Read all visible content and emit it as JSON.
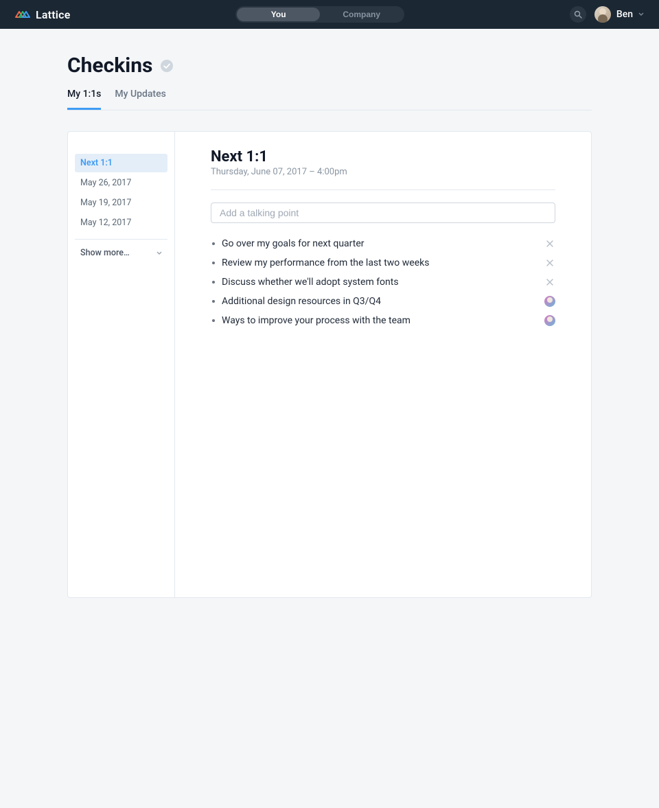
{
  "topbar": {
    "brand_name": "Lattice",
    "toggle": {
      "you": "You",
      "company": "Company"
    },
    "user_name": "Ben"
  },
  "page": {
    "title": "Checkins",
    "tabs": [
      {
        "label": "My 1:1s",
        "active": true
      },
      {
        "label": "My Updates",
        "active": false
      }
    ]
  },
  "sidebar": {
    "items": [
      {
        "label": "Next 1:1",
        "active": true
      },
      {
        "label": "May 26, 2017",
        "active": false
      },
      {
        "label": "May 19, 2017",
        "active": false
      },
      {
        "label": "May 12, 2017",
        "active": false
      }
    ],
    "show_more_label": "Show more…"
  },
  "meeting": {
    "title": "Next 1:1",
    "subtitle": "Thursday, June 07, 2017 – 4:00pm",
    "input_placeholder": "Add a talking point",
    "points": [
      {
        "text": "Go over my goals for next quarter",
        "action": "close"
      },
      {
        "text": "Review my performance from the last two weeks",
        "action": "close"
      },
      {
        "text": "Discuss whether we'll adopt system fonts",
        "action": "close"
      },
      {
        "text": "Additional design resources in Q3/Q4",
        "action": "avatar"
      },
      {
        "text": "Ways to improve your process with the team",
        "action": "avatar"
      }
    ]
  }
}
